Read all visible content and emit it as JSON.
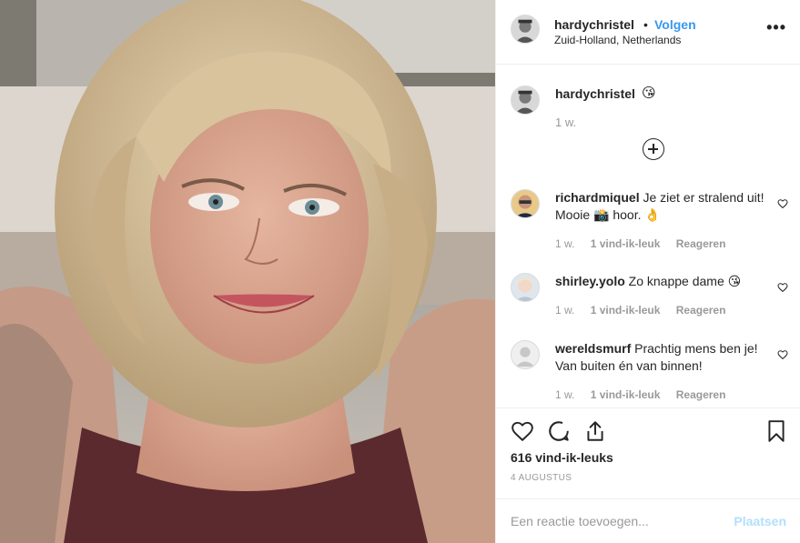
{
  "header": {
    "username": "hardychristel",
    "separator": "•",
    "follow_label": "Volgen",
    "location": "Zuid-Holland, Netherlands",
    "more_label": "•••"
  },
  "caption": {
    "username": "hardychristel",
    "emoji": "😘",
    "time": "1 w."
  },
  "comments": [
    {
      "username": "richardmiquel",
      "text": "Je ziet er stralend uit! Mooie 📸 hoor. 👌",
      "time": "1 w.",
      "likes": "1 vind-ik-leuk",
      "reply": "Reageren"
    },
    {
      "username": "shirley.yolo",
      "text": "Zo knappe dame 😘",
      "time": "1 w.",
      "likes": "1 vind-ik-leuk",
      "reply": "Reageren"
    },
    {
      "username": "wereldsmurf",
      "text": "Prachtig mens ben je! Van buiten én van binnen!",
      "time": "1 w.",
      "likes": "1 vind-ik-leuk",
      "reply": "Reageren"
    }
  ],
  "actions": {
    "like_count": "616 vind-ik-leuks",
    "date": "4 AUGUSTUS"
  },
  "add_comment": {
    "placeholder": "Een reactie toevoegen...",
    "post_label": "Plaatsen"
  },
  "colors": {
    "link_blue": "#3897f0",
    "muted": "#999999",
    "post_disabled": "#b2dffc"
  }
}
